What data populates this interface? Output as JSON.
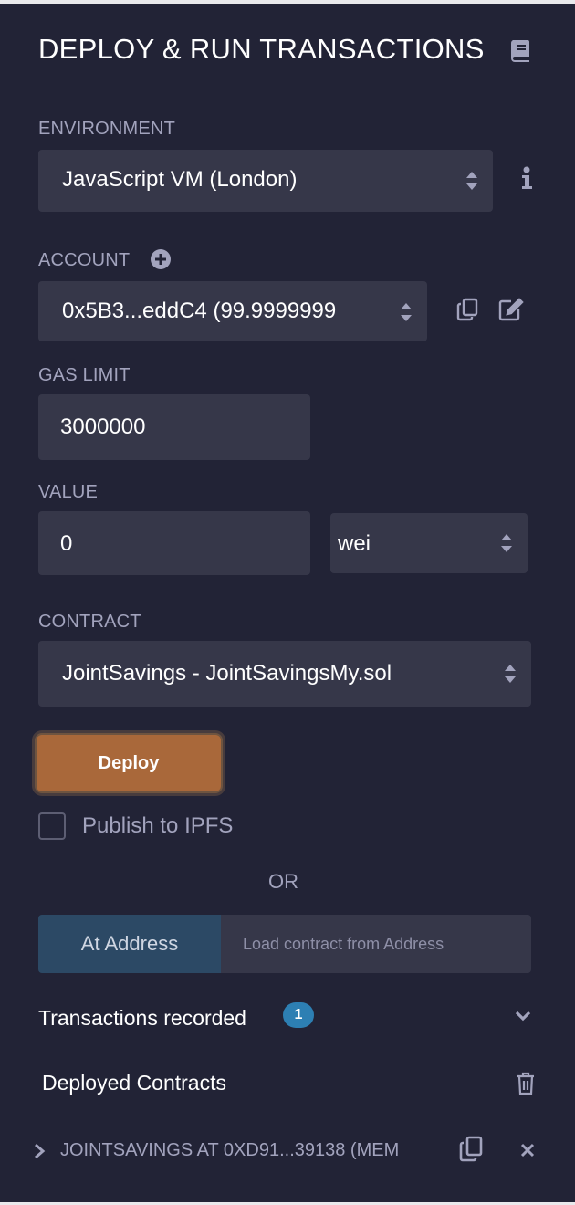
{
  "panel": {
    "title": "DEPLOY & RUN TRANSACTIONS",
    "docs_icon": "book-icon"
  },
  "environment": {
    "label": "ENVIRONMENT",
    "value": "JavaScript VM (London)",
    "info_icon": "info-icon"
  },
  "account": {
    "label": "ACCOUNT",
    "add_icon": "plus-circle-icon",
    "value": "0x5B3...eddC4 (99.9999999",
    "copy_icon": "copy-icon",
    "edit_icon": "edit-icon"
  },
  "gas_limit": {
    "label": "GAS LIMIT",
    "value": "3000000"
  },
  "value": {
    "label": "VALUE",
    "amount": "0",
    "unit": "wei"
  },
  "contract": {
    "label": "CONTRACT",
    "value": "JointSavings - JointSavingsMy.sol"
  },
  "deploy": {
    "button_label": "Deploy",
    "publish_label": "Publish to IPFS",
    "publish_checked": false
  },
  "or_text": "OR",
  "at_address": {
    "button_label": "At Address",
    "placeholder": "Load contract from Address"
  },
  "transactions": {
    "label": "Transactions recorded",
    "count": "1",
    "toggle_icon": "chevron-down-icon"
  },
  "deployed": {
    "label": "Deployed Contracts",
    "clear_icon": "trash-icon",
    "items": [
      {
        "label": "JOINTSAVINGS AT 0XD91...39138 (MEM",
        "expand_icon": "chevron-right-icon",
        "copy_icon": "copy-icon",
        "close_icon": "close-icon"
      }
    ]
  },
  "colors": {
    "background": "#222336",
    "field": "#363749",
    "label": "#a2a3bd",
    "deploy_button": "#a9683a",
    "at_address_button": "#2c4965",
    "badge": "#2d7fb3"
  }
}
